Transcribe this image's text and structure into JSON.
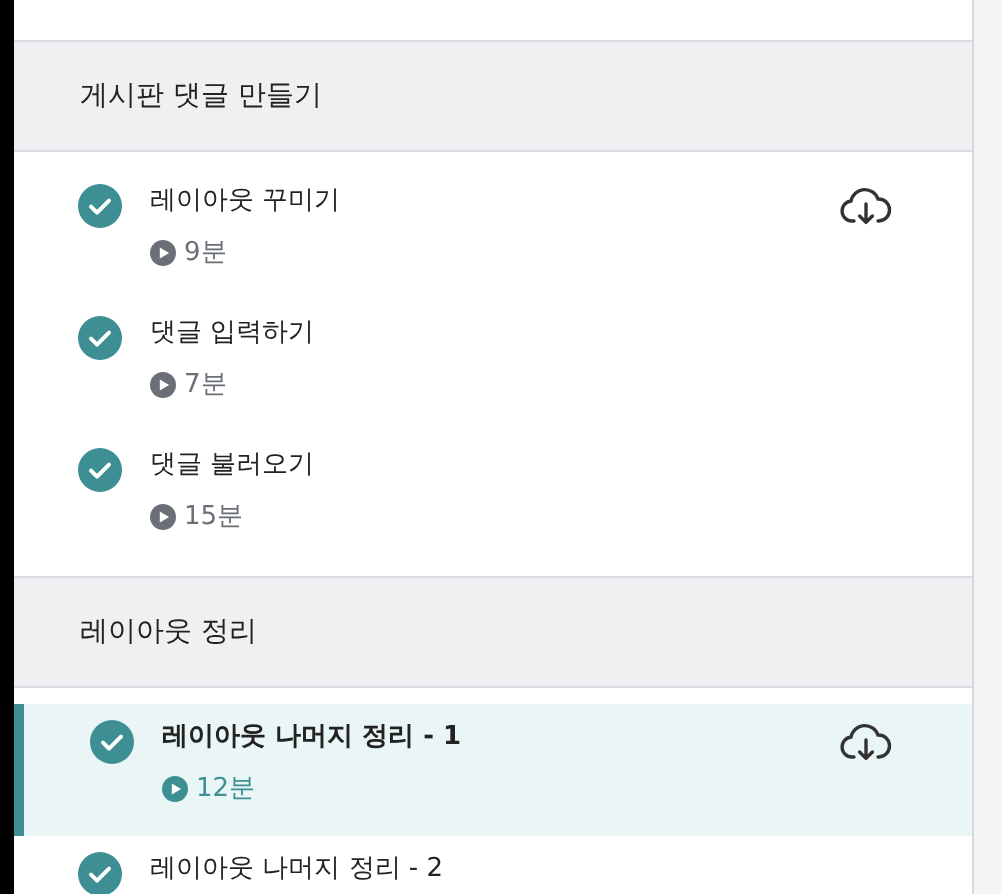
{
  "sections": [
    {
      "title": "게시판 댓글 만들기",
      "lessons": [
        {
          "title": "레이아웃 꾸미기",
          "duration": "9분",
          "completed": true,
          "selected": false,
          "downloadable": true
        },
        {
          "title": "댓글 입력하기",
          "duration": "7분",
          "completed": true,
          "selected": false,
          "downloadable": false
        },
        {
          "title": "댓글 불러오기",
          "duration": "15분",
          "completed": true,
          "selected": false,
          "downloadable": false
        }
      ]
    },
    {
      "title": "레이아웃 정리",
      "lessons": [
        {
          "title": "레이아웃 나머지 정리 - 1",
          "duration": "12분",
          "completed": true,
          "selected": true,
          "downloadable": true
        },
        {
          "title": "레이아웃 나머지 정리 - 2",
          "completed": true,
          "selected": false,
          "downloadable": false
        }
      ]
    }
  ]
}
